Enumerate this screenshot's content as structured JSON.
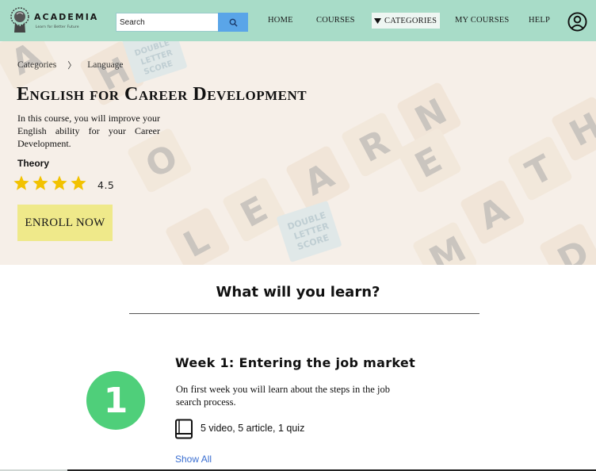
{
  "brand": {
    "name": "ACADEMIA",
    "tagline": "Learn for Better Future",
    "nav_color": "#a8dcc8"
  },
  "search": {
    "placeholder": "Search",
    "icon": "search-icon"
  },
  "nav": {
    "home": "HOME",
    "courses": "COURSES",
    "categories": "CATEGORIES",
    "my_courses": "MY COURSES",
    "help": "HELP",
    "user_icon": "user-circle-icon"
  },
  "breadcrumb": {
    "root": "Categories",
    "separator": "〉",
    "current": "Language"
  },
  "course": {
    "title": "English for Career Development",
    "description": "In this course, you will improve your English ability for your Career Development.",
    "type": "Theory",
    "rating": "4.5",
    "stars_filled": 4,
    "stars_total": 4,
    "enroll_label": "ENROLL NOW"
  },
  "hero_tiles": {
    "double_letter_score": [
      "DOUBLE",
      "LETTER",
      "SCORE"
    ],
    "letters": [
      "H",
      "O",
      "L",
      "E",
      "A",
      "R",
      "N",
      "E",
      "A",
      "T",
      "H",
      "M",
      "D",
      "A"
    ]
  },
  "learn": {
    "heading": "What will you learn?",
    "weeks": [
      {
        "number": "1",
        "title": "Week 1: Entering the job market",
        "description": "On first week you will learn about the steps in the job search process.",
        "meta": "5 video, 5 article, 1 quiz",
        "show_all": "Show All"
      }
    ]
  },
  "colors": {
    "accent_green": "#4fcf7a",
    "enroll_yellow": "#efe98a",
    "search_button": "#5aa5e8",
    "link_blue": "#3b6fd1"
  }
}
